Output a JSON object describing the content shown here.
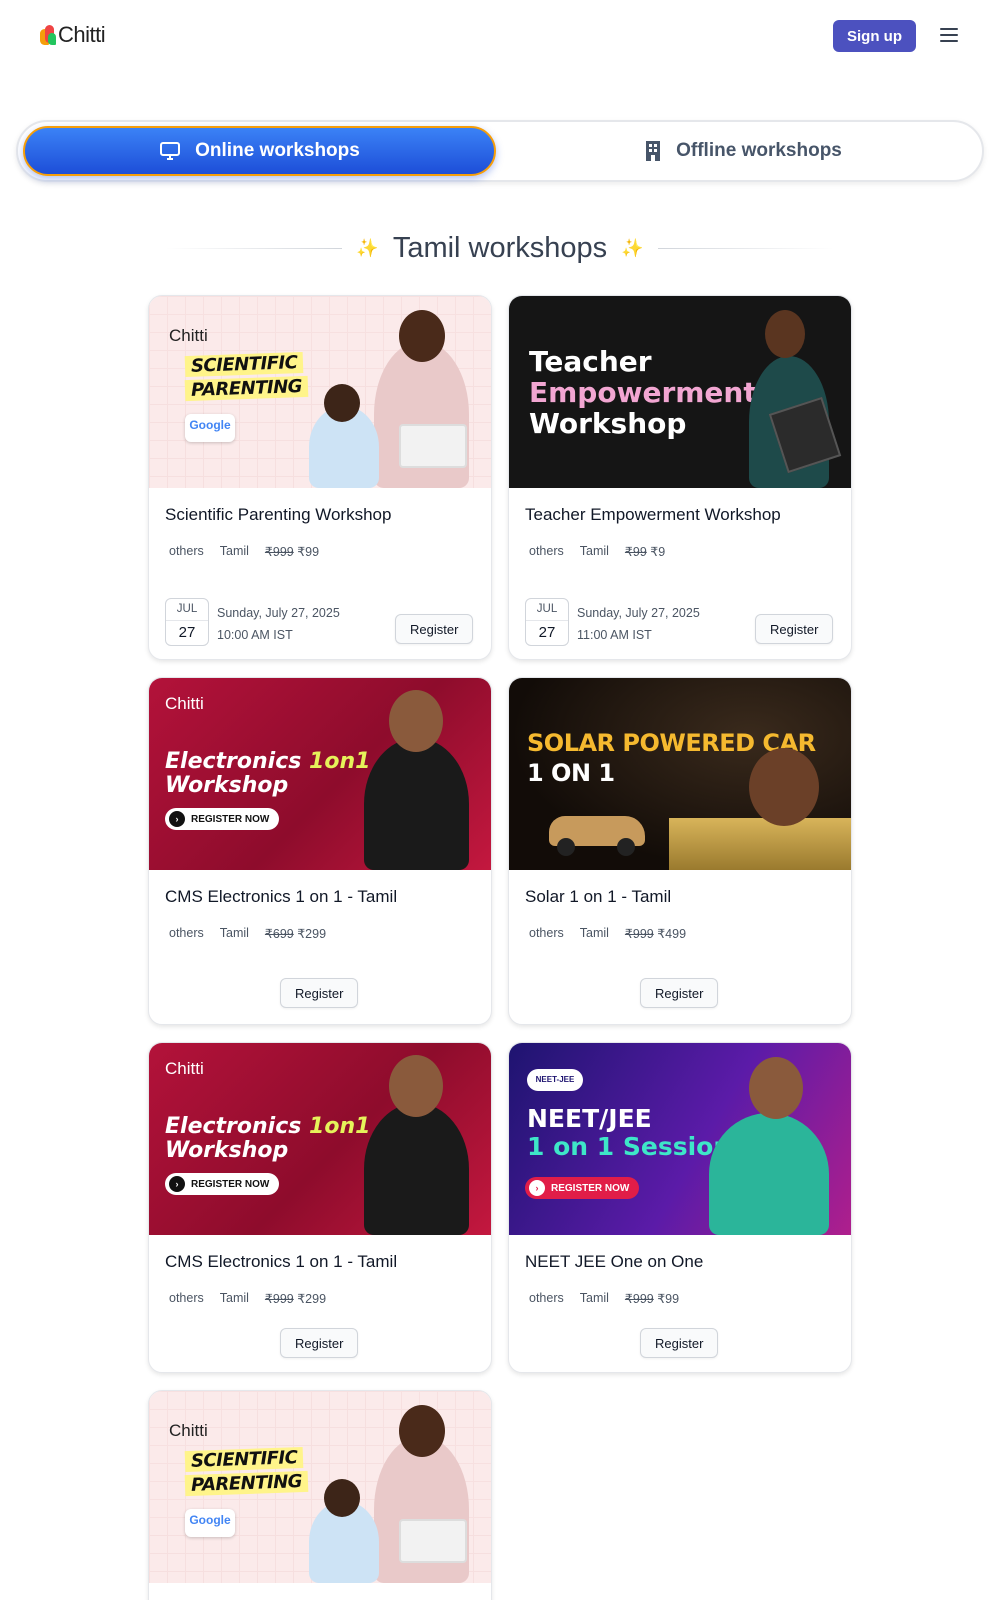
{
  "header": {
    "logo_text": "Chitti",
    "signup_label": "Sign up"
  },
  "tabs": {
    "online": "Online workshops",
    "offline": "Offline workshops"
  },
  "section": {
    "title": "Tamil workshops"
  },
  "cards": [
    {
      "title": "Scientific Parenting Workshop",
      "category": "others",
      "language": "Tamil",
      "old_price": "₹999",
      "price": "₹99",
      "month": "JUL",
      "day": "27",
      "date": "Sunday, July 27, 2025",
      "time": "10:00 AM IST",
      "register": "Register",
      "banner": {
        "logo": "Chitti",
        "line1": "SCIENTIFIC",
        "line2": "PARENTING",
        "badge": "Google"
      }
    },
    {
      "title": "Teacher Empowerment Workshop",
      "category": "others",
      "language": "Tamil",
      "old_price": "₹99",
      "price": "₹9",
      "month": "JUL",
      "day": "27",
      "date": "Sunday, July 27, 2025",
      "time": "11:00 AM IST",
      "register": "Register",
      "banner": {
        "line1": "Teacher",
        "line2": "Empowerment",
        "line3": "Workshop"
      }
    },
    {
      "title": "CMS Electronics 1 on 1 - Tamil",
      "category": "others",
      "language": "Tamil",
      "old_price": "₹699",
      "price": "₹299",
      "register": "Register",
      "banner": {
        "logo": "Chitti",
        "line1a": "Electronics ",
        "line1b": "1on1",
        "line2": "Workshop",
        "cta": "REGISTER NOW"
      }
    },
    {
      "title": "Solar 1 on 1 - Tamil",
      "category": "others",
      "language": "Tamil",
      "old_price": "₹999",
      "price": "₹499",
      "register": "Register",
      "banner": {
        "line1": "SOLAR POWERED CAR",
        "line2": "1 ON 1"
      }
    },
    {
      "title": "CMS Electronics 1 on 1 - Tamil",
      "category": "others",
      "language": "Tamil",
      "old_price": "₹999",
      "price": "₹299",
      "register": "Register",
      "banner": {
        "logo": "Chitti",
        "line1a": "Electronics ",
        "line1b": "1on1",
        "line2": "Workshop",
        "cta": "REGISTER NOW"
      }
    },
    {
      "title": "NEET JEE One on One",
      "category": "others",
      "language": "Tamil",
      "old_price": "₹999",
      "price": "₹99",
      "register": "Register",
      "banner": {
        "badge": "NEET-JEE",
        "line1": "NEET/JEE",
        "line2": "1 on 1 Session",
        "cta": "REGISTER NOW"
      }
    },
    {
      "banner": {
        "logo": "Chitti",
        "line1": "SCIENTIFIC",
        "line2": "PARENTING",
        "badge": "Google"
      }
    }
  ],
  "colors": {
    "signup_bg": "#4c51bf",
    "online_tab": "#2563eb",
    "tab_border": "#f59e0b"
  }
}
